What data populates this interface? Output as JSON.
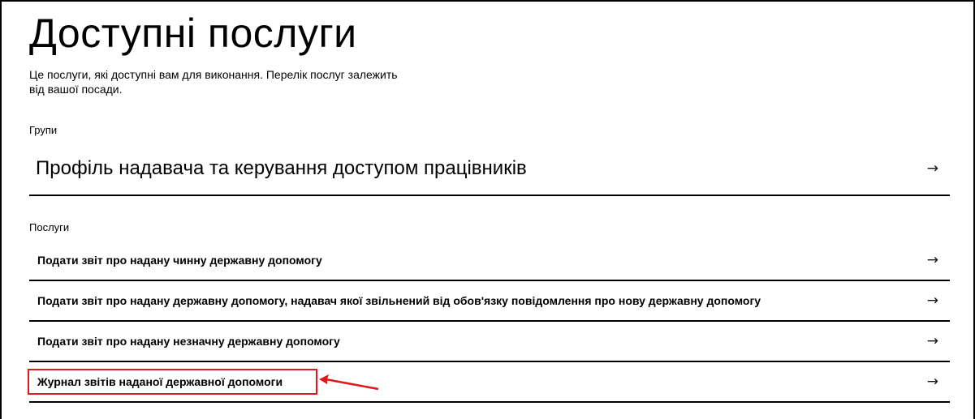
{
  "page": {
    "title": "Доступні послуги",
    "description": "Це послуги, які доступні вам для виконання. Перелік послуг залежить від вашої посади."
  },
  "groups": {
    "label": "Групи",
    "items": [
      {
        "label": "Профіль надавача та керування доступом працівників"
      }
    ]
  },
  "services": {
    "label": "Послуги",
    "items": [
      {
        "label": "Подати звіт про надану чинну державну допомогу"
      },
      {
        "label": "Подати звіт про надану державну допомогу, надавач якої звільнений від обов'язку повідомлення про нову державну допомогу"
      },
      {
        "label": "Подати звіт про надану незначну державну допомогу"
      },
      {
        "label": "Журнал звітів наданої державної допомоги",
        "highlighted": true
      }
    ]
  },
  "icons": {
    "row_arrow": "→"
  },
  "annotation": {
    "color": "#e0181b",
    "shape": "rectangle-with-arrow"
  }
}
